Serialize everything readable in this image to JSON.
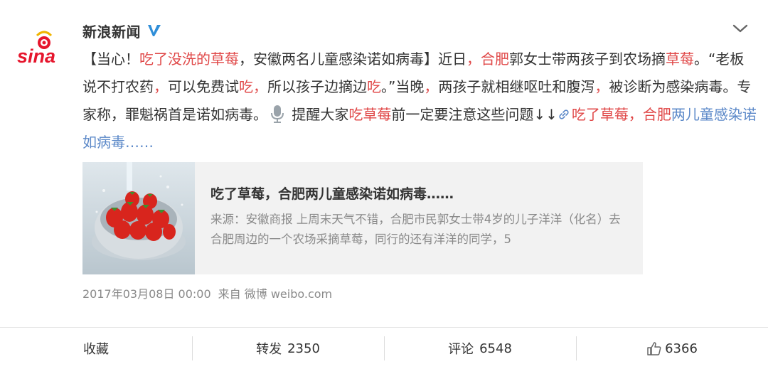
{
  "author": {
    "name": "新浪新闻",
    "avatar_icon": "sina-logo"
  },
  "post": {
    "segments": [
      {
        "text": "【当心！",
        "style": "normal"
      },
      {
        "text": "吃了没洗的草莓",
        "style": "hl"
      },
      {
        "text": "，安徽两名儿童感染诺如病毒】近日",
        "style": "normal"
      },
      {
        "text": "，合肥",
        "style": "hl"
      },
      {
        "text": "郭女士带两孩子到农场摘",
        "style": "normal"
      },
      {
        "text": "草莓",
        "style": "hl"
      },
      {
        "text": "。“老板说不打农药",
        "style": "normal"
      },
      {
        "text": "，",
        "style": "hl"
      },
      {
        "text": "可以免费试",
        "style": "normal"
      },
      {
        "text": "吃，",
        "style": "hl"
      },
      {
        "text": "所以孩子边摘边",
        "style": "normal"
      },
      {
        "text": "吃",
        "style": "hl"
      },
      {
        "text": "。”当晚",
        "style": "normal"
      },
      {
        "text": "，",
        "style": "hl"
      },
      {
        "text": "两孩子就相继呕吐和腹泻",
        "style": "normal"
      },
      {
        "text": "，",
        "style": "hl"
      },
      {
        "text": "被诊断为感染病毒。专家称，罪魁祸首是诺如病毒。",
        "style": "normal"
      },
      {
        "text": "",
        "style": "mic"
      },
      {
        "text": " 提醒大家",
        "style": "normal"
      },
      {
        "text": "吃草莓",
        "style": "hl"
      },
      {
        "text": "前一定要注意这些问题↓↓",
        "style": "normal"
      },
      {
        "text": "",
        "style": "link-icon"
      },
      {
        "text": "吃了草莓，合肥",
        "style": "hl"
      },
      {
        "text": "两儿童感染诺如病毒……",
        "style": "lk"
      }
    ]
  },
  "card": {
    "image_icon": "strawberries-in-colander",
    "title": "吃了草莓，合肥两儿童感染诺如病毒……",
    "description": "来源：安徽商报 上周末天气不错，合肥市民郭女士带4岁的儿子洋洋（化名）去合肥周边的一个农场采摘草莓，同行的还有洋洋的同学，5"
  },
  "meta": {
    "time": "2017年03月08日 00:00",
    "source": "来自 微博 weibo.com"
  },
  "footer": {
    "favorite_label": "收藏",
    "repost_label": "转发",
    "repost_count": "2350",
    "comment_label": "评论",
    "comment_count": "6548",
    "like_count": "6366"
  },
  "colors": {
    "highlight": "#e04848",
    "link": "#5b88c8",
    "verified": "#2f8ed8",
    "brand": "#e6162d"
  }
}
